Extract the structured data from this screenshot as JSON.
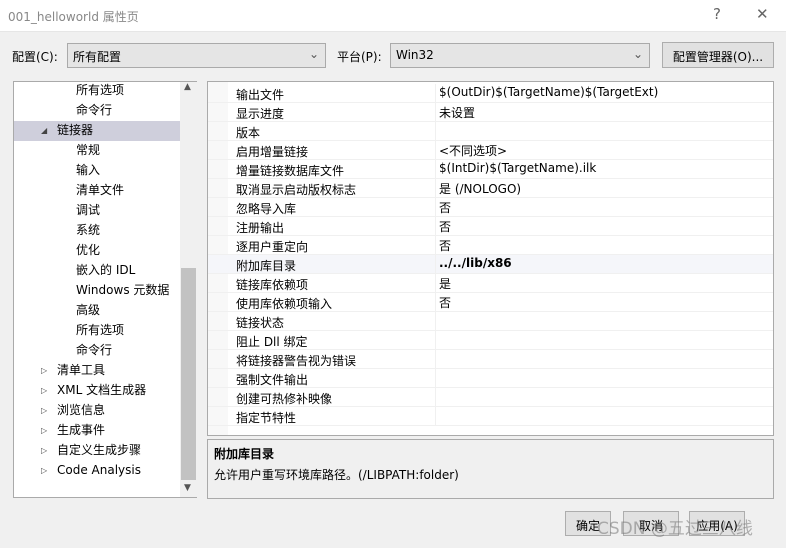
{
  "window": {
    "title": "001_helloworld 属性页",
    "help": "?",
    "close": "✕"
  },
  "config": {
    "label": "配置(C):",
    "value": "所有配置",
    "platform_label": "平台(P):",
    "platform_value": "Win32",
    "manager_button": "配置管理器(O)..."
  },
  "tree": {
    "items": [
      {
        "label": "所有选项",
        "indent": 2
      },
      {
        "label": "命令行",
        "indent": 2
      },
      {
        "label": "链接器",
        "indent": 1,
        "expanded": true,
        "selected": true
      },
      {
        "label": "常规",
        "indent": 2
      },
      {
        "label": "输入",
        "indent": 2
      },
      {
        "label": "清单文件",
        "indent": 2
      },
      {
        "label": "调试",
        "indent": 2
      },
      {
        "label": "系统",
        "indent": 2
      },
      {
        "label": "优化",
        "indent": 2
      },
      {
        "label": "嵌入的 IDL",
        "indent": 2
      },
      {
        "label": "Windows 元数据",
        "indent": 2
      },
      {
        "label": "高级",
        "indent": 2
      },
      {
        "label": "所有选项",
        "indent": 2
      },
      {
        "label": "命令行",
        "indent": 2
      },
      {
        "label": "清单工具",
        "indent": 1,
        "expanded": false
      },
      {
        "label": "XML 文档生成器",
        "indent": 1,
        "expanded": false
      },
      {
        "label": "浏览信息",
        "indent": 1,
        "expanded": false
      },
      {
        "label": "生成事件",
        "indent": 1,
        "expanded": false
      },
      {
        "label": "自定义生成步骤",
        "indent": 1,
        "expanded": false
      },
      {
        "label": "Code Analysis",
        "indent": 1,
        "expanded": false
      }
    ]
  },
  "properties": [
    {
      "name": "输出文件",
      "value": "$(OutDir)$(TargetName)$(TargetExt)"
    },
    {
      "name": "显示进度",
      "value": "未设置"
    },
    {
      "name": "版本",
      "value": ""
    },
    {
      "name": "启用增量链接",
      "value": "<不同选项>"
    },
    {
      "name": "增量链接数据库文件",
      "value": "$(IntDir)$(TargetName).ilk"
    },
    {
      "name": "取消显示启动版权标志",
      "value": "是 (/NOLOGO)"
    },
    {
      "name": "忽略导入库",
      "value": "否"
    },
    {
      "name": "注册输出",
      "value": "否"
    },
    {
      "name": "逐用户重定向",
      "value": "否"
    },
    {
      "name": "附加库目录",
      "value": "../../lib/x86",
      "bold": true
    },
    {
      "name": "链接库依赖项",
      "value": "是"
    },
    {
      "name": "使用库依赖项输入",
      "value": "否"
    },
    {
      "name": "链接状态",
      "value": ""
    },
    {
      "name": "阻止 Dll 绑定",
      "value": ""
    },
    {
      "name": "将链接器警告视为错误",
      "value": ""
    },
    {
      "name": "强制文件输出",
      "value": ""
    },
    {
      "name": "创建可热修补映像",
      "value": ""
    },
    {
      "name": "指定节特性",
      "value": ""
    }
  ],
  "description": {
    "title": "附加库目录",
    "text": "允许用户重写环境库路径。(/LIBPATH:folder)"
  },
  "buttons": {
    "ok": "确定",
    "cancel": "取消",
    "apply": "应用(A)"
  },
  "watermark": "CSDN @五过三八线"
}
